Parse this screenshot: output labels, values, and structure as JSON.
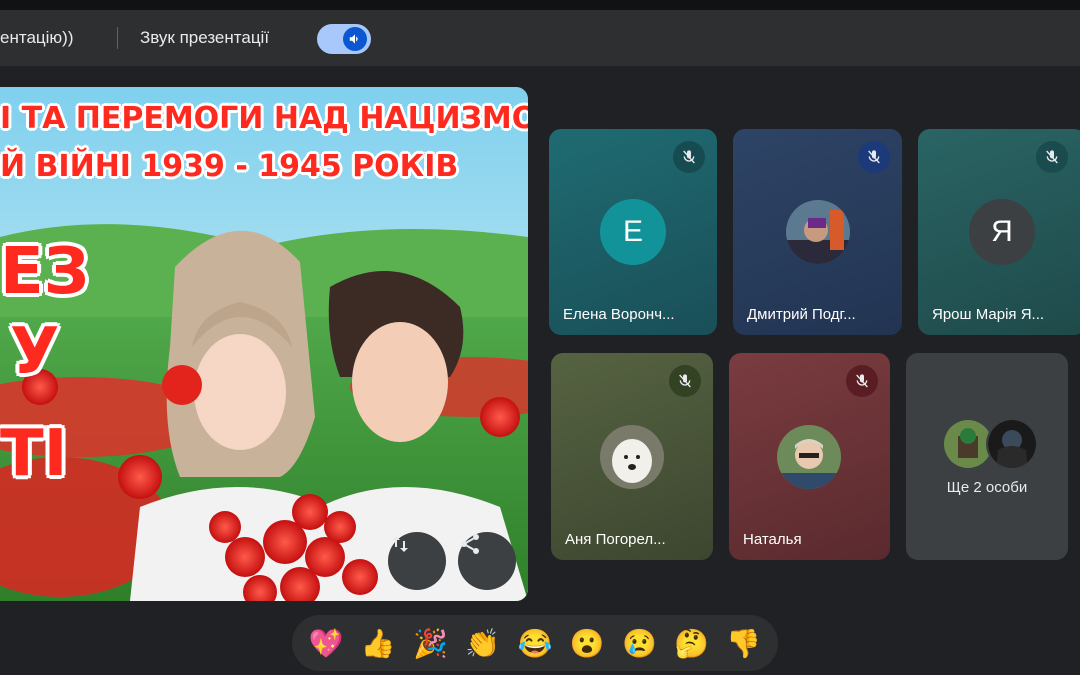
{
  "presentation_bar": {
    "title": "ентацію))",
    "sound_label": "Звук презентації",
    "sound_enabled": true
  },
  "slide": {
    "title_line1": "І ТА ПЕРЕМОГИ НАД НАЦИЗМОМ",
    "title_line2": "Й ВІЙНІ 1939 - 1945 РОКІВ",
    "big_line1": "ЕЗ",
    "big_line2": "У",
    "big_line3": "ТІ",
    "controls": [
      {
        "icon": "swap-vertical-icon"
      },
      {
        "icon": "share-icon"
      }
    ]
  },
  "participants": [
    {
      "name": "Елена Ворончиха...",
      "display_name": "Елена Воронч...",
      "avatar_letter": "Е",
      "avatar_color": "#12939a",
      "tile_color": "#1f5e66",
      "muted": true
    },
    {
      "name": "Дмитрий Подг...",
      "display_name": "Дмитрий Подг...",
      "avatar_type": "photo",
      "tile_color": "#2a3e5e",
      "muted": true
    },
    {
      "name": "Ярош Марія Я...",
      "display_name": "Ярош Марія Я...",
      "avatar_letter": "Я",
      "avatar_color": "#3c4043",
      "tile_color": "#255656",
      "muted": true
    },
    {
      "name": "Аня Погорел...",
      "display_name": "Аня Погорел...",
      "avatar_type": "photo",
      "tile_color": "#4f5a38",
      "muted": true
    },
    {
      "name": "Наталья",
      "display_name": "Наталья",
      "avatar_type": "photo",
      "tile_color": "#6b3438",
      "muted": true
    }
  ],
  "more_tile": {
    "label": "Ще 2 особи"
  },
  "reactions": [
    {
      "emoji": "💖",
      "icon": "sparkling-heart-icon"
    },
    {
      "emoji": "👍",
      "icon": "thumbs-up-icon"
    },
    {
      "emoji": "🎉",
      "icon": "party-popper-icon"
    },
    {
      "emoji": "👏",
      "icon": "clapping-hands-icon"
    },
    {
      "emoji": "😂",
      "icon": "tears-of-joy-icon"
    },
    {
      "emoji": "😮",
      "icon": "surprised-face-icon"
    },
    {
      "emoji": "😢",
      "icon": "crying-face-icon"
    },
    {
      "emoji": "🤔",
      "icon": "thinking-face-icon"
    },
    {
      "emoji": "👎",
      "icon": "thumbs-down-icon"
    }
  ]
}
